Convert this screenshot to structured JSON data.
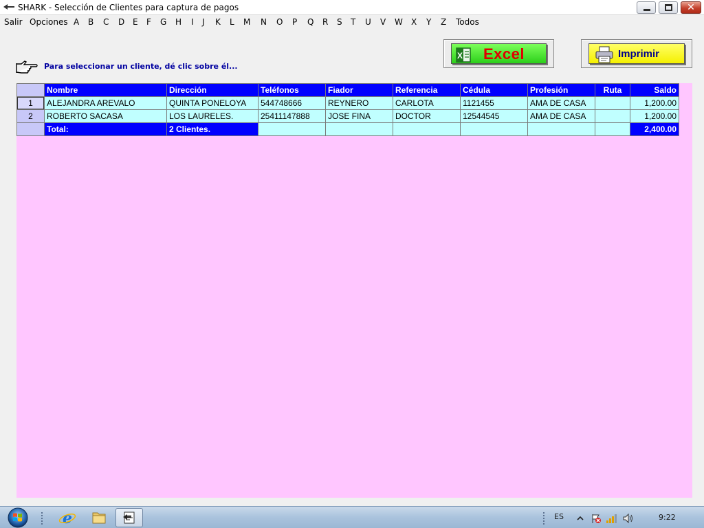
{
  "window": {
    "title": "SHARK - Selección de Clientes para captura de pagos"
  },
  "menu": [
    "Salir",
    "Opciones",
    "A",
    "B",
    "C",
    "D",
    "E",
    "F",
    "G",
    "H",
    "I",
    "J",
    "K",
    "L",
    "M",
    "N",
    "O",
    "P",
    "Q",
    "R",
    "S",
    "T",
    "U",
    "V",
    "W",
    "X",
    "Y",
    "Z",
    "Todos"
  ],
  "toolbar": {
    "instruction": "Para seleccionar un cliente, dé clic sobre él...",
    "excel_label": "Excel",
    "print_label": "Imprimir"
  },
  "grid": {
    "columns": [
      "Nombre",
      "Dirección",
      "Teléfonos",
      "Fiador",
      "Referencia",
      "Cédula",
      "Profesión",
      "Ruta",
      "Saldo"
    ],
    "rows": [
      {
        "num": "1",
        "nombre": "ALEJANDRA AREVALO",
        "direccion": "QUINTA PONELOYA",
        "telefonos": "544748666",
        "fiador": "REYNERO",
        "referencia": "CARLOTA",
        "cedula": "1121455",
        "profesion": "AMA DE CASA",
        "ruta": "",
        "saldo": "1,200.00"
      },
      {
        "num": "2",
        "nombre": "ROBERTO SACASA",
        "direccion": "LOS LAURELES.",
        "telefonos": "25411147888",
        "fiador": "JOSE FINA",
        "referencia": "DOCTOR",
        "cedula": "12544545",
        "profesion": "AMA DE CASA",
        "ruta": "",
        "saldo": "1,200.00"
      }
    ],
    "total": {
      "label": "Total:",
      "clients": "2 Clientes.",
      "saldo": "2,400.00"
    }
  },
  "taskbar": {
    "language": "ES",
    "clock": "9:22"
  },
  "colors": {
    "grid_header": "#0000ff",
    "grid_cell": "#c0ffff",
    "grid_background": "#ffc6ff",
    "instruction_text": "#0000a0",
    "excel_button": "#2ccf1a",
    "print_button": "#f5f000"
  }
}
